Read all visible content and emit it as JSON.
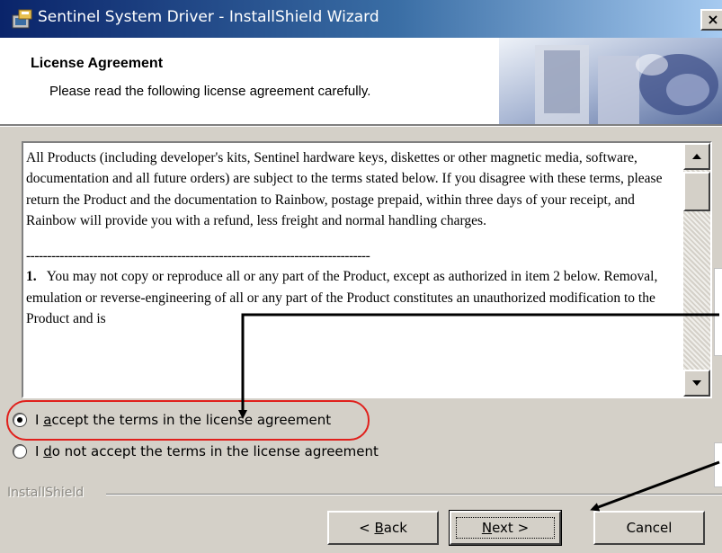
{
  "window": {
    "title": "Sentinel System Driver - InstallShield Wizard",
    "close_glyph": "×"
  },
  "header": {
    "title": "License Agreement",
    "subtitle": "Please read the following license agreement carefully."
  },
  "license": {
    "paragraph1": "All Products (including developer's kits, Sentinel hardware keys, diskettes or other magnetic media, software, documentation and all future orders) are subject to the terms stated below. If you disagree with these terms, please return the Product and the documentation to Rainbow, postage prepaid, within three days of your receipt, and Rainbow will provide you with a refund, less freight and normal handling charges.",
    "separator": "----------------------------------------------------------------------------------",
    "item1_number": "1.",
    "item1_text": "You may not copy or reproduce all or any part of the Product, except as authorized in item 2 below. Removal, emulation or reverse-engineering of all or any part of the Product constitutes an unauthorized modification to the Product and is",
    "scroll_up_icon": "triangle-up",
    "scroll_down_icon": "triangle-down"
  },
  "options": {
    "accept_prefix": "I ",
    "accept_hotkey": "a",
    "accept_rest": "ccept the terms in the license agreement",
    "accept_selected": true,
    "decline_prefix": "I ",
    "decline_hotkey": "d",
    "decline_rest": "o not accept the terms in the license agreement",
    "decline_selected": false
  },
  "footer": {
    "brand": "InstallShield",
    "back_prefix": "< ",
    "back_hotkey": "B",
    "back_rest": "ack",
    "next_hotkey": "N",
    "next_rest": "ext >",
    "cancel_label": "Cancel"
  },
  "annotations": {
    "highlight_color": "#e0201c",
    "arrow_color": "#000000"
  }
}
